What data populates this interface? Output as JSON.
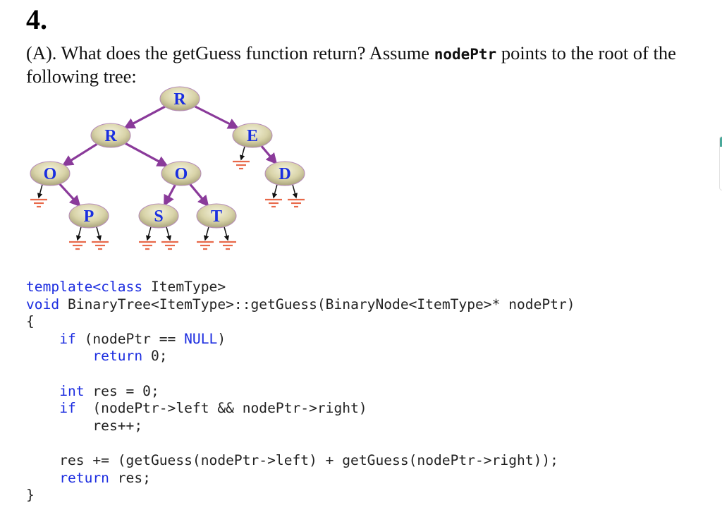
{
  "question": {
    "number": "4.",
    "prompt_before": "(A). What does the getGuess function return? Assume ",
    "prompt_code": "nodePtr",
    "prompt_after": " points to the root of the following tree:"
  },
  "tree": {
    "nodes": [
      {
        "id": "root",
        "label": "R",
        "left": "r2",
        "right": "e"
      },
      {
        "id": "r2",
        "label": "R",
        "left": "o1",
        "right": "o2"
      },
      {
        "id": "e",
        "label": "E",
        "left": null,
        "right": "d"
      },
      {
        "id": "o1",
        "label": "O",
        "left": null,
        "right": "p"
      },
      {
        "id": "o2",
        "label": "O",
        "left": "s",
        "right": "t"
      },
      {
        "id": "d",
        "label": "D",
        "left": null,
        "right": null
      },
      {
        "id": "p",
        "label": "P",
        "left": null,
        "right": null
      },
      {
        "id": "s",
        "label": "S",
        "left": null,
        "right": null
      },
      {
        "id": "t",
        "label": "T",
        "left": null,
        "right": null
      }
    ],
    "colors": {
      "edge": "#8a3a9a",
      "null_pointer": "#111111",
      "ground": "#e8694a",
      "label": "#1a2fe0",
      "node_fill": "#dcd8b0"
    }
  },
  "code": {
    "lines": [
      [
        {
          "t": "template<class",
          "kw": true
        },
        {
          "t": " ItemType>",
          "kw": false
        }
      ],
      [
        {
          "t": "void",
          "kw": true
        },
        {
          "t": " BinaryTree<ItemType>::getGuess(BinaryNode<ItemType>* nodePtr)",
          "kw": false
        }
      ],
      [
        {
          "t": "{",
          "kw": false
        }
      ],
      [
        {
          "t": "    ",
          "kw": false
        },
        {
          "t": "if",
          "kw": true
        },
        {
          "t": " (nodePtr == ",
          "kw": false
        },
        {
          "t": "NULL",
          "kw": true
        },
        {
          "t": ")",
          "kw": false
        }
      ],
      [
        {
          "t": "        ",
          "kw": false
        },
        {
          "t": "return",
          "kw": true
        },
        {
          "t": " 0;",
          "kw": false
        }
      ],
      [
        {
          "t": "",
          "kw": false
        }
      ],
      [
        {
          "t": "    ",
          "kw": false
        },
        {
          "t": "int",
          "kw": true
        },
        {
          "t": " res = 0;",
          "kw": false
        }
      ],
      [
        {
          "t": "    ",
          "kw": false
        },
        {
          "t": "if",
          "kw": true
        },
        {
          "t": "  (nodePtr->left && nodePtr->right)",
          "kw": false
        }
      ],
      [
        {
          "t": "        res++;",
          "kw": false
        }
      ],
      [
        {
          "t": "",
          "kw": false
        }
      ],
      [
        {
          "t": "    res += (getGuess(nodePtr->left) + getGuess(nodePtr->right));",
          "kw": false
        }
      ],
      [
        {
          "t": "    ",
          "kw": false
        },
        {
          "t": "return",
          "kw": true
        },
        {
          "t": " res;",
          "kw": false
        }
      ],
      [
        {
          "t": "}",
          "kw": false
        }
      ]
    ]
  }
}
